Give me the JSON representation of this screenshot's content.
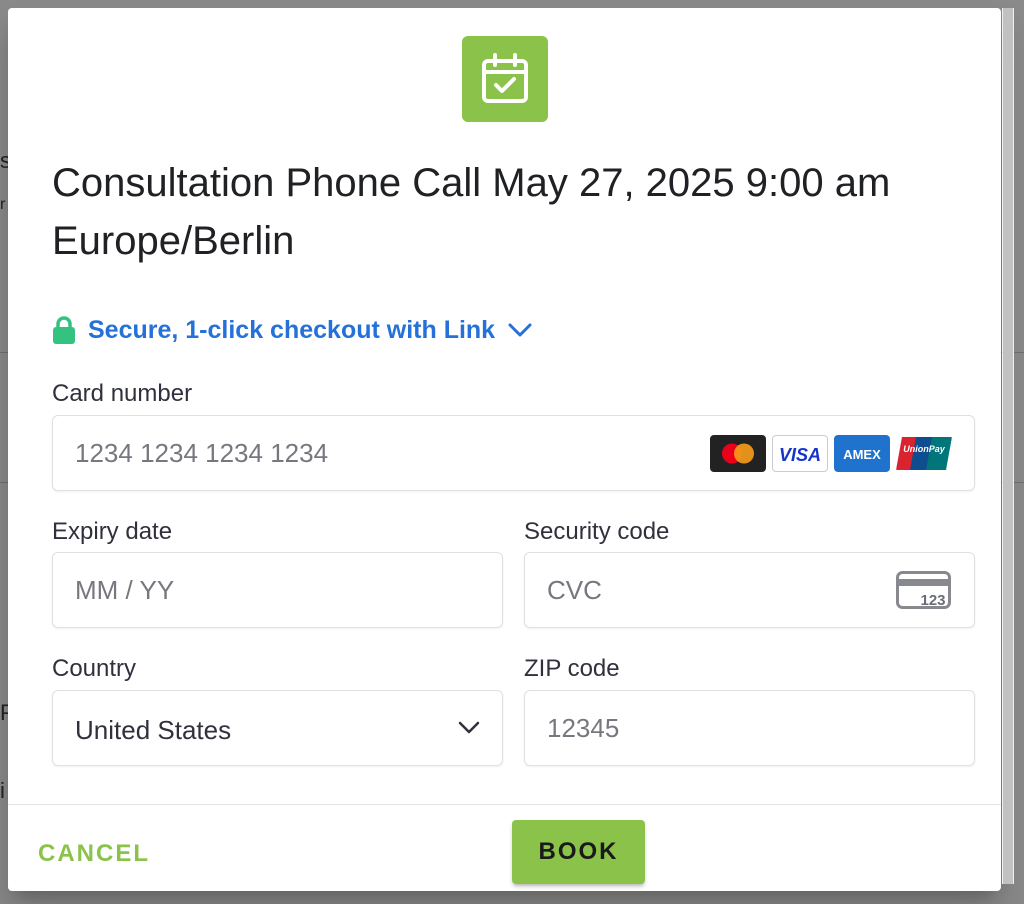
{
  "background": {
    "fragments": [
      "s",
      "r",
      "Pa",
      "i"
    ]
  },
  "header": {
    "title": "Consultation Phone Call May 27, 2025 9:00 am Europe/Berlin",
    "icon": "calendar-check-icon"
  },
  "link": {
    "label": "Secure, 1-click checkout with Link"
  },
  "form": {
    "card_number": {
      "label": "Card number",
      "placeholder": "1234 1234 1234 1234"
    },
    "card_brands": [
      "mastercard",
      "VISA",
      "AMEX",
      "UnionPay"
    ],
    "expiry": {
      "label": "Expiry date",
      "placeholder": "MM / YY"
    },
    "cvc": {
      "label": "Security code",
      "placeholder": "CVC",
      "hint": "123"
    },
    "country": {
      "label": "Country",
      "value": "United States"
    },
    "zip": {
      "label": "ZIP code",
      "placeholder": "12345"
    }
  },
  "footer": {
    "cancel_label": "CANCEL",
    "book_label": "BOOK"
  },
  "colors": {
    "accent": "#8bc34a",
    "link": "#2571d9",
    "lock": "#33c27f"
  }
}
